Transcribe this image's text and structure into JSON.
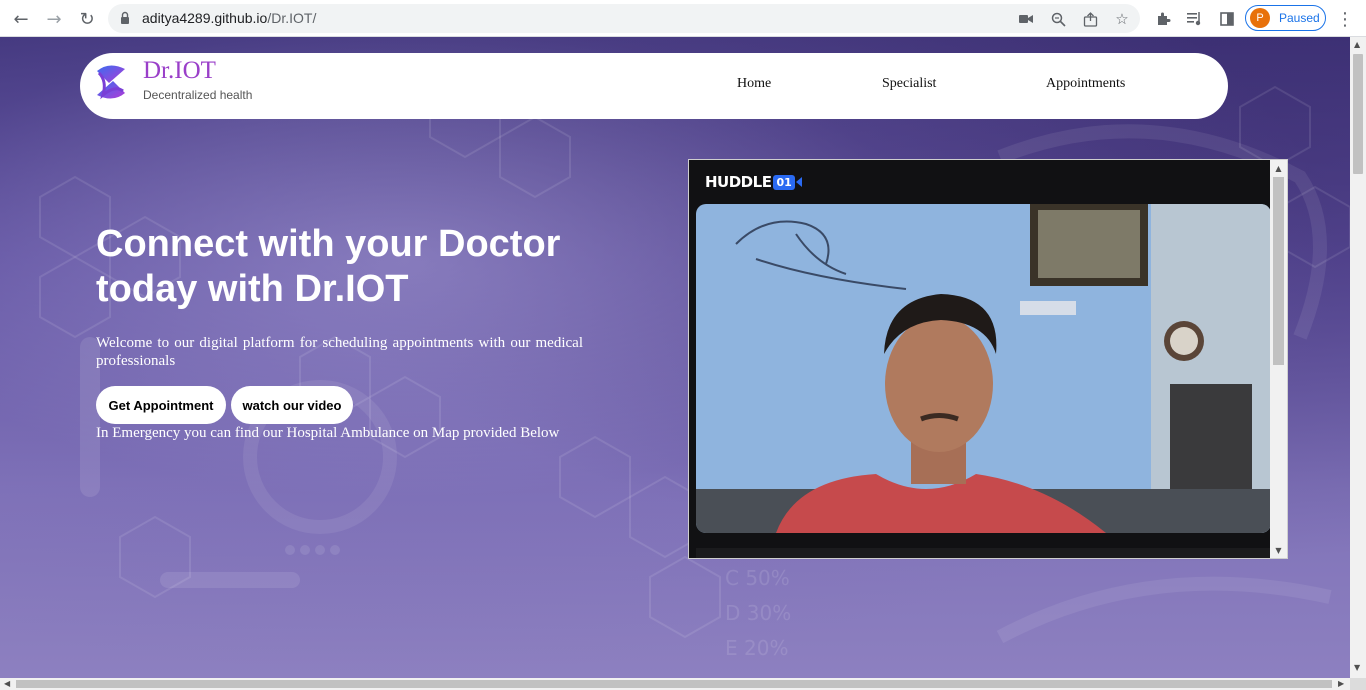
{
  "browser": {
    "url_host": "aditya4289.github.io",
    "url_path": "/Dr.IOT/",
    "profile_initial": "P",
    "profile_status": "Paused"
  },
  "navbar": {
    "brand": "Dr.IOT",
    "tagline": "Decentralized health",
    "links": [
      "Home",
      "Specialist",
      "Appointments"
    ]
  },
  "hero": {
    "title": "Connect with your Doctor today with Dr.IOT",
    "description": "Welcome to our digital platform for scheduling appointments with our medical professionals",
    "primary_button": "Get Appointment",
    "secondary_button": "watch our video",
    "emergency_text": "In Emergency you can find our Hospital Ambulance on Map provided Below"
  },
  "video_call": {
    "brand_text": "HUDDLE",
    "brand_number": "01"
  },
  "colors": {
    "brand_purple": "#9a3fc9",
    "accent_blue": "#1a73e8",
    "huddle_blue": "#2a6af2"
  }
}
